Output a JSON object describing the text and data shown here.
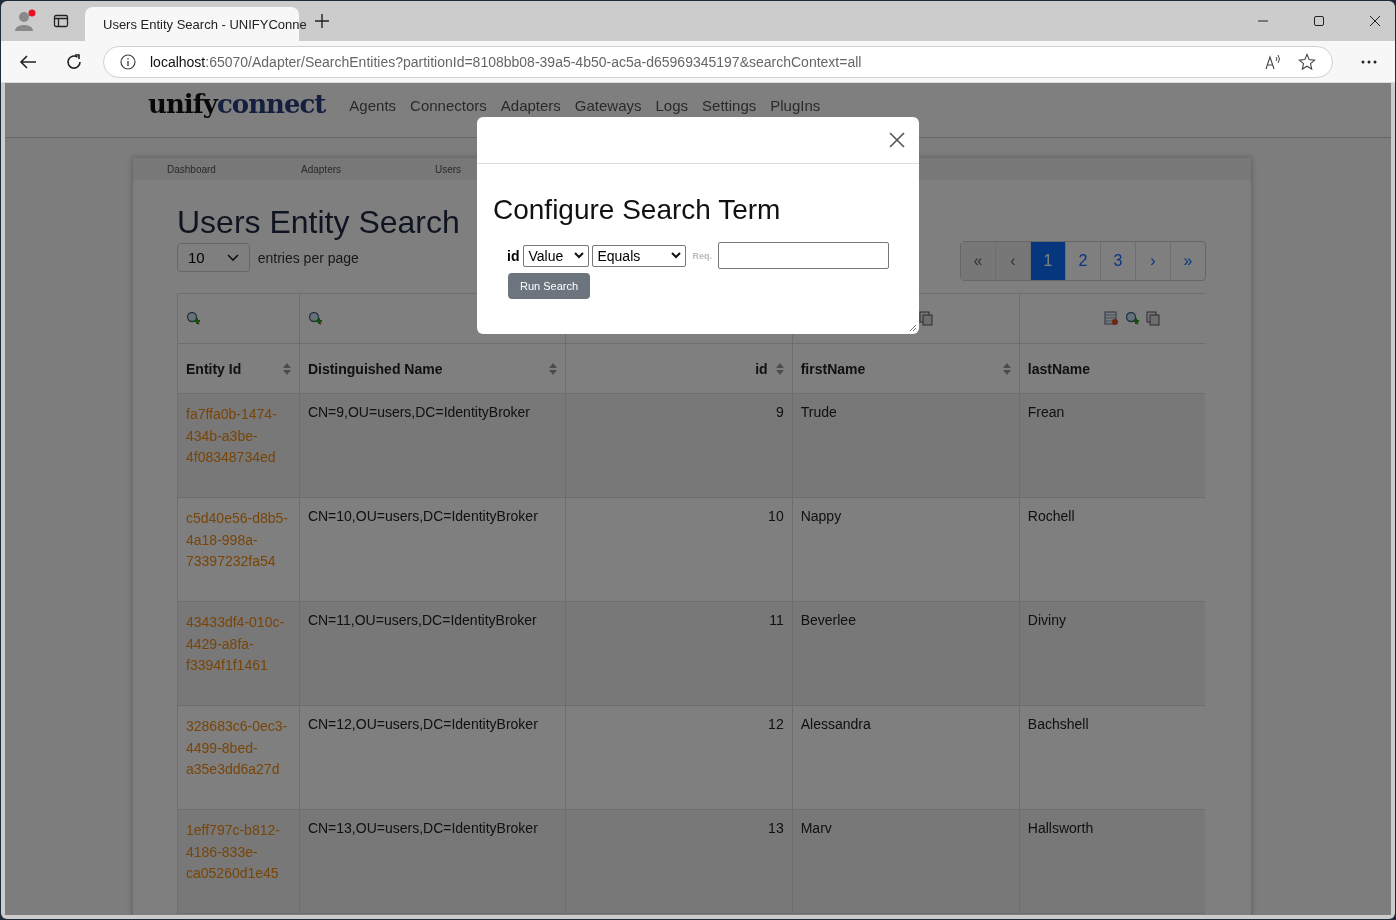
{
  "browser": {
    "tab_title": "Users Entity Search - UNIFYConne",
    "url": {
      "host": "localhost",
      "rest": ":65070/Adapter/SearchEntities?partitionId=8108bb08-39a5-4b50-ac5a-d65969345197&searchContext=all"
    }
  },
  "header": {
    "logo": {
      "part1": "unify",
      "part2": "connect"
    },
    "nav": [
      "Agents",
      "Connectors",
      "Adapters",
      "Gateways",
      "Logs",
      "Settings",
      "PlugIns"
    ]
  },
  "breadcrumb": [
    "Dashboard",
    "Adapters",
    "Users"
  ],
  "page_title": "Users Entity Search",
  "page_size": {
    "value": "10",
    "label": "entries per page"
  },
  "pagination": [
    {
      "label": "«",
      "selected": false
    },
    {
      "label": "‹",
      "selected": false
    },
    {
      "label": "1",
      "selected": true
    },
    {
      "label": "2",
      "selected": false
    },
    {
      "label": "3",
      "selected": false
    },
    {
      "label": "›",
      "selected": false
    },
    {
      "label": "»",
      "selected": false
    }
  ],
  "table": {
    "columns": [
      {
        "label": "Entity Id",
        "kind": "system",
        "numeric": false
      },
      {
        "label": "Distinguished Name",
        "kind": "system",
        "numeric": false
      },
      {
        "label": "id",
        "kind": "attribute",
        "numeric": true
      },
      {
        "label": "firstName",
        "kind": "attribute",
        "numeric": false
      },
      {
        "label": "lastName",
        "kind": "attribute",
        "numeric": false
      }
    ],
    "rows": [
      [
        "fa7ffa0b-1474-434b-a3be-4f08348734ed",
        "CN=9,OU=users,DC=IdentityBroker",
        "9",
        "Trude",
        "Frean"
      ],
      [
        "c5d40e56-d8b5-4a18-998a-73397232fa54",
        "CN=10,OU=users,DC=IdentityBroker",
        "10",
        "Nappy",
        "Rochell"
      ],
      [
        "43433df4-010c-4429-a8fa-f3394f1f1461",
        "CN=11,OU=users,DC=IdentityBroker",
        "11",
        "Beverlee",
        "Diviny"
      ],
      [
        "328683c6-0ec3-4499-8bed-a35e3dd6a27d",
        "CN=12,OU=users,DC=IdentityBroker",
        "12",
        "Alessandra",
        "Bachshell"
      ],
      [
        "1eff797c-b812-4186-833e-ca05260d1e45",
        "CN=13,OU=users,DC=IdentityBroker",
        "13",
        "Marv",
        "Hallsworth"
      ]
    ]
  },
  "modal": {
    "title": "Configure Search Term",
    "field_label": "id",
    "source": "Value",
    "operator": "Equals",
    "required_hint": "Req.",
    "button": "Run Search"
  }
}
